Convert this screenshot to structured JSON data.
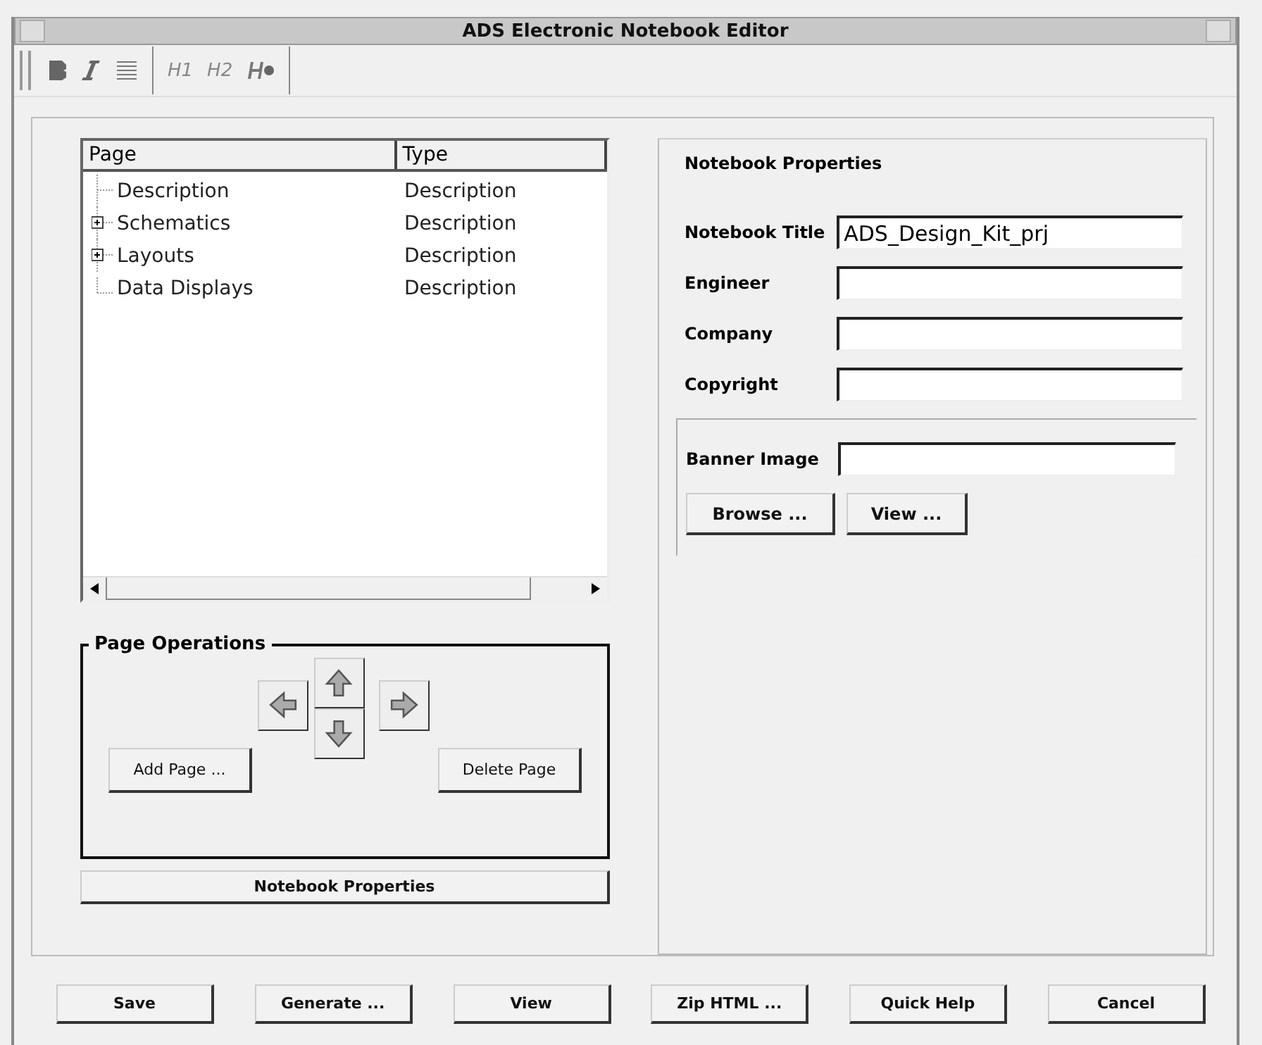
{
  "window": {
    "title": "ADS Electronic Notebook Editor"
  },
  "toolbar": [
    {
      "kind": "bold"
    },
    {
      "kind": "italic"
    },
    {
      "kind": "align"
    },
    {
      "kind": "separator"
    },
    {
      "kind": "text",
      "label": "H1"
    },
    {
      "kind": "text",
      "label": "H2"
    },
    {
      "kind": "heading"
    }
  ],
  "tree": {
    "columns": [
      "Page",
      "Type"
    ],
    "rows": [
      {
        "kind": "leaf",
        "page": "Description",
        "type": "Description"
      },
      {
        "kind": "branch",
        "expanded": false,
        "page": "Schematics",
        "type": "Description"
      },
      {
        "kind": "branch",
        "expanded": false,
        "page": "Layouts",
        "type": "Description"
      },
      {
        "kind": "leaf",
        "page": "Data Displays",
        "type": "Description"
      }
    ]
  },
  "page_operations": {
    "title": "Page Operations",
    "add": "Add Page ...",
    "delete": "Delete Page"
  },
  "notebook_properties_button": "Notebook Properties",
  "properties": {
    "title": "Notebook Properties",
    "fields": [
      {
        "label": "Notebook Title",
        "value": "ADS_Design_Kit_prj"
      },
      {
        "label": "Engineer"
      },
      {
        "label": "Company"
      },
      {
        "label": "Copyright"
      }
    ],
    "banner": {
      "label": "Banner Image",
      "buttons": [
        "Browse ...",
        "View ..."
      ]
    }
  },
  "buttons": [
    "Save",
    "Generate ...",
    "View",
    "Zip HTML ...",
    "Quick Help",
    "Cancel"
  ]
}
